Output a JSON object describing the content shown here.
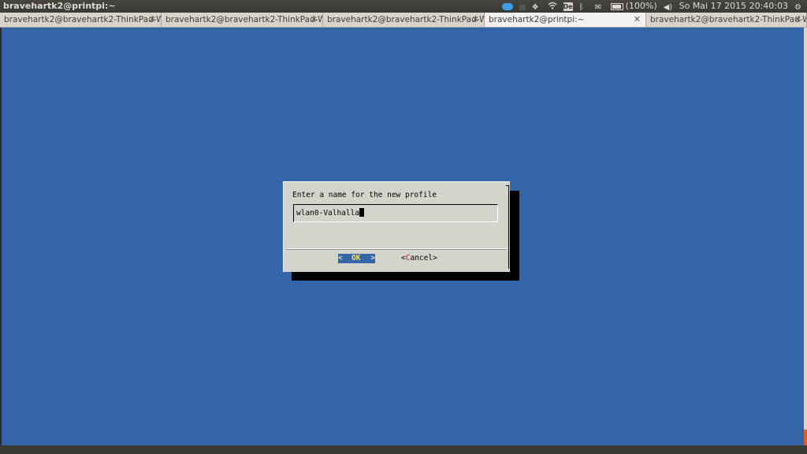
{
  "panel": {
    "window_title": "bravehartk2@printpi:~",
    "battery": "(100%)",
    "keyboard_layout": "De",
    "datetime": "So Mai 17 2015 20:40:03",
    "icons": [
      "cloud-icon",
      "lock-icon",
      "dropbox-icon",
      "wifi-icon",
      "keyboard-layout-icon",
      "bluetooth-icon",
      "mail-icon",
      "battery-icon",
      "volume-icon",
      "settings-icon"
    ]
  },
  "tabs": [
    {
      "label": "bravehartk2@bravehartk2-ThinkPad-W...",
      "close": "✕"
    },
    {
      "label": "bravehartk2@bravehartk2-ThinkPad-W...",
      "close": "✕"
    },
    {
      "label": "bravehartk2@bravehartk2-ThinkPad-W...",
      "close": "✕"
    },
    {
      "label": "bravehartk2@printpi:~",
      "close": "✕"
    },
    {
      "label": "bravehartk2@bravehartk2-ThinkPad-W...",
      "close": "✕"
    }
  ],
  "dialog": {
    "prompt": "Enter a name for the new profile",
    "input_value": "wlan0-Valhalla",
    "ok": {
      "left": "<",
      "label": "OK",
      "right": ">"
    },
    "cancel": {
      "left": "<",
      "hotkey": "C",
      "rest": "ancel",
      "right": ">"
    }
  },
  "colors": {
    "terminal_bg": "#3465a8",
    "dialog_bg": "#d3d5cc",
    "ok_highlight": "#3465a8",
    "cancel_hotkey": "#c0191a"
  }
}
